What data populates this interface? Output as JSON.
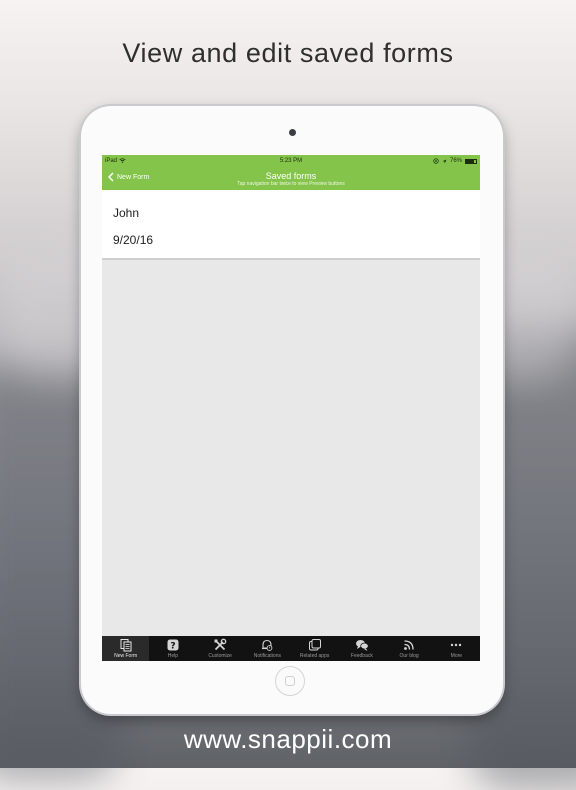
{
  "headline": "View and edit saved forms",
  "footer_url": "www.snappii.com",
  "status_bar": {
    "carrier": "iPad",
    "time": "5:23 PM",
    "battery": "76%"
  },
  "nav": {
    "back_label": "New Form",
    "title": "Saved forms",
    "subtitle": "Tap navigation bar twice to view Preview buttons"
  },
  "saved_forms": [
    {
      "name": "John",
      "date": "9/20/16"
    }
  ],
  "tabs": [
    {
      "label": "New Form",
      "icon": "new-form-icon",
      "active": true
    },
    {
      "label": "Help",
      "icon": "help-icon",
      "active": false
    },
    {
      "label": "Customize",
      "icon": "tools-icon",
      "active": false
    },
    {
      "label": "Notifications",
      "icon": "notifications-icon",
      "active": false
    },
    {
      "label": "Related apps",
      "icon": "related-apps-icon",
      "active": false
    },
    {
      "label": "Feedback",
      "icon": "feedback-icon",
      "active": false
    },
    {
      "label": "Our blog",
      "icon": "rss-icon",
      "active": false
    },
    {
      "label": "More",
      "icon": "more-icon",
      "active": false
    }
  ],
  "colors": {
    "nav_green": "#84c44a",
    "tab_bar": "#121212",
    "battery_level": 0.76
  }
}
